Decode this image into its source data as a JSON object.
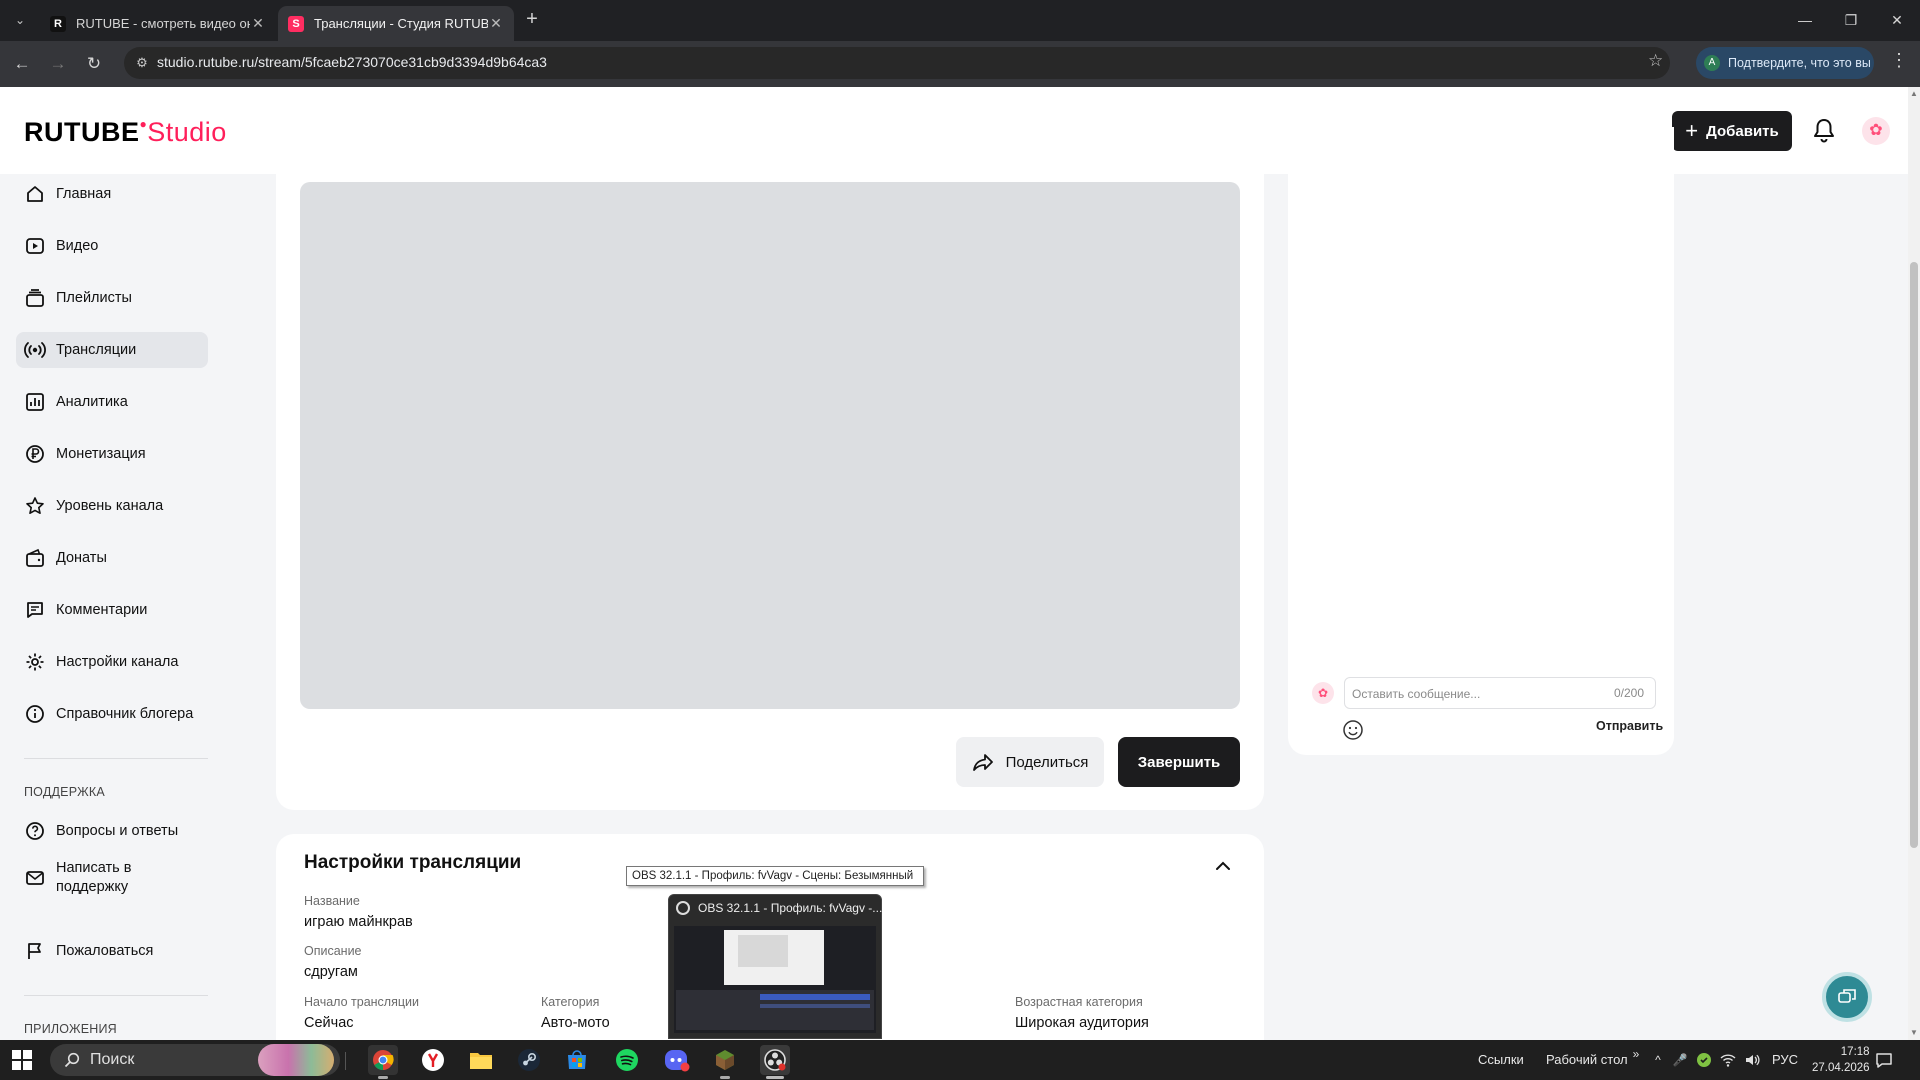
{
  "browser": {
    "tabs": [
      {
        "title": "RUTUBE - смотреть видео онлайн",
        "favicon": "R",
        "active": false
      },
      {
        "title": "Трансляции - Студия RUTUBE",
        "favicon": "S",
        "active": true
      }
    ],
    "url": "studio.rutube.ru/stream/5fcaeb273070ce31cb9d3394d9b64ca3",
    "profile_chip": "Подтвердите, что это вы"
  },
  "header": {
    "logo_main": "RUTUBE",
    "logo_sub": "Studio",
    "add_button": "Добавить"
  },
  "sidebar": {
    "items": [
      {
        "label": "Главная",
        "icon": "home-icon"
      },
      {
        "label": "Видео",
        "icon": "video-icon"
      },
      {
        "label": "Плейлисты",
        "icon": "playlist-icon"
      },
      {
        "label": "Трансляции",
        "icon": "broadcast-icon",
        "active": true
      },
      {
        "label": "Аналитика",
        "icon": "analytics-icon"
      },
      {
        "label": "Монетизация",
        "icon": "ruble-icon"
      },
      {
        "label": "Уровень канала",
        "icon": "star-icon"
      },
      {
        "label": "Донаты",
        "icon": "wallet-icon"
      },
      {
        "label": "Комментарии",
        "icon": "comment-icon"
      },
      {
        "label": "Настройки канала",
        "icon": "gear-icon"
      },
      {
        "label": "Справочник блогера",
        "icon": "info-icon"
      }
    ],
    "support_title": "ПОДДЕРЖКА",
    "support_items": [
      {
        "label": "Вопросы и ответы",
        "icon": "question-icon"
      },
      {
        "label": "Написать в поддержку",
        "icon": "mail-icon"
      },
      {
        "label": "Пожаловаться",
        "icon": "flag-icon"
      }
    ],
    "apps_title": "ПРИЛОЖЕНИЯ"
  },
  "stream": {
    "share_button": "Поделиться",
    "finish_button": "Завершить"
  },
  "chat": {
    "placeholder": "Оставить сообщение...",
    "counter": "0/200",
    "send_button": "Отправить"
  },
  "settings": {
    "title": "Настройки трансляции",
    "fields": {
      "name_label": "Название",
      "name_value": "играю майнкрав",
      "description_label": "Описание",
      "description_value": "сдругам",
      "start_label": "Начало трансляции",
      "start_value": "Сейчас",
      "category_label": "Категория",
      "category_value": "Авто-мото",
      "age_label": "Возрастная категория",
      "age_value": "Широкая аудитория"
    }
  },
  "obs": {
    "tooltip": "OBS 32.1.1 - Профиль: fvVagv - Сцены: Безымянный",
    "thumb_title": "OBS 32.1.1 - Профиль: fvVagv -..."
  },
  "taskbar": {
    "search": "Поиск",
    "links": "Ссылки",
    "desktop": "Рабочий стол",
    "lang": "РУС",
    "time": "17:18",
    "date": "27.04.2026"
  },
  "colors": {
    "brand": "#ff1f5a",
    "dark_button": "#1c1c1e",
    "support_fab": "#2e8a94"
  }
}
